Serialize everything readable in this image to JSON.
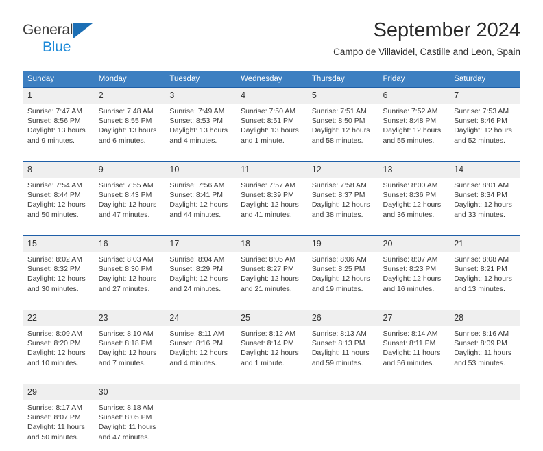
{
  "brand": {
    "name_top": "General",
    "name_bottom": "Blue",
    "triangle_color": "#1c6fb5",
    "blue_color": "#1c89d8"
  },
  "header": {
    "month_title": "September 2024",
    "location": "Campo de Villavidel, Castille and Leon, Spain"
  },
  "theme": {
    "header_bg": "#3d7fc1",
    "week_separator": "#1f5fa8",
    "daynum_bg": "#efefef"
  },
  "weekday_headers": [
    "Sunday",
    "Monday",
    "Tuesday",
    "Wednesday",
    "Thursday",
    "Friday",
    "Saturday"
  ],
  "weeks": [
    {
      "days": [
        {
          "num": "1",
          "sunrise": "Sunrise: 7:47 AM",
          "sunset": "Sunset: 8:56 PM",
          "daylight_1": "Daylight: 13 hours",
          "daylight_2": "and 9 minutes."
        },
        {
          "num": "2",
          "sunrise": "Sunrise: 7:48 AM",
          "sunset": "Sunset: 8:55 PM",
          "daylight_1": "Daylight: 13 hours",
          "daylight_2": "and 6 minutes."
        },
        {
          "num": "3",
          "sunrise": "Sunrise: 7:49 AM",
          "sunset": "Sunset: 8:53 PM",
          "daylight_1": "Daylight: 13 hours",
          "daylight_2": "and 4 minutes."
        },
        {
          "num": "4",
          "sunrise": "Sunrise: 7:50 AM",
          "sunset": "Sunset: 8:51 PM",
          "daylight_1": "Daylight: 13 hours",
          "daylight_2": "and 1 minute."
        },
        {
          "num": "5",
          "sunrise": "Sunrise: 7:51 AM",
          "sunset": "Sunset: 8:50 PM",
          "daylight_1": "Daylight: 12 hours",
          "daylight_2": "and 58 minutes."
        },
        {
          "num": "6",
          "sunrise": "Sunrise: 7:52 AM",
          "sunset": "Sunset: 8:48 PM",
          "daylight_1": "Daylight: 12 hours",
          "daylight_2": "and 55 minutes."
        },
        {
          "num": "7",
          "sunrise": "Sunrise: 7:53 AM",
          "sunset": "Sunset: 8:46 PM",
          "daylight_1": "Daylight: 12 hours",
          "daylight_2": "and 52 minutes."
        }
      ]
    },
    {
      "days": [
        {
          "num": "8",
          "sunrise": "Sunrise: 7:54 AM",
          "sunset": "Sunset: 8:44 PM",
          "daylight_1": "Daylight: 12 hours",
          "daylight_2": "and 50 minutes."
        },
        {
          "num": "9",
          "sunrise": "Sunrise: 7:55 AM",
          "sunset": "Sunset: 8:43 PM",
          "daylight_1": "Daylight: 12 hours",
          "daylight_2": "and 47 minutes."
        },
        {
          "num": "10",
          "sunrise": "Sunrise: 7:56 AM",
          "sunset": "Sunset: 8:41 PM",
          "daylight_1": "Daylight: 12 hours",
          "daylight_2": "and 44 minutes."
        },
        {
          "num": "11",
          "sunrise": "Sunrise: 7:57 AM",
          "sunset": "Sunset: 8:39 PM",
          "daylight_1": "Daylight: 12 hours",
          "daylight_2": "and 41 minutes."
        },
        {
          "num": "12",
          "sunrise": "Sunrise: 7:58 AM",
          "sunset": "Sunset: 8:37 PM",
          "daylight_1": "Daylight: 12 hours",
          "daylight_2": "and 38 minutes."
        },
        {
          "num": "13",
          "sunrise": "Sunrise: 8:00 AM",
          "sunset": "Sunset: 8:36 PM",
          "daylight_1": "Daylight: 12 hours",
          "daylight_2": "and 36 minutes."
        },
        {
          "num": "14",
          "sunrise": "Sunrise: 8:01 AM",
          "sunset": "Sunset: 8:34 PM",
          "daylight_1": "Daylight: 12 hours",
          "daylight_2": "and 33 minutes."
        }
      ]
    },
    {
      "days": [
        {
          "num": "15",
          "sunrise": "Sunrise: 8:02 AM",
          "sunset": "Sunset: 8:32 PM",
          "daylight_1": "Daylight: 12 hours",
          "daylight_2": "and 30 minutes."
        },
        {
          "num": "16",
          "sunrise": "Sunrise: 8:03 AM",
          "sunset": "Sunset: 8:30 PM",
          "daylight_1": "Daylight: 12 hours",
          "daylight_2": "and 27 minutes."
        },
        {
          "num": "17",
          "sunrise": "Sunrise: 8:04 AM",
          "sunset": "Sunset: 8:29 PM",
          "daylight_1": "Daylight: 12 hours",
          "daylight_2": "and 24 minutes."
        },
        {
          "num": "18",
          "sunrise": "Sunrise: 8:05 AM",
          "sunset": "Sunset: 8:27 PM",
          "daylight_1": "Daylight: 12 hours",
          "daylight_2": "and 21 minutes."
        },
        {
          "num": "19",
          "sunrise": "Sunrise: 8:06 AM",
          "sunset": "Sunset: 8:25 PM",
          "daylight_1": "Daylight: 12 hours",
          "daylight_2": "and 19 minutes."
        },
        {
          "num": "20",
          "sunrise": "Sunrise: 8:07 AM",
          "sunset": "Sunset: 8:23 PM",
          "daylight_1": "Daylight: 12 hours",
          "daylight_2": "and 16 minutes."
        },
        {
          "num": "21",
          "sunrise": "Sunrise: 8:08 AM",
          "sunset": "Sunset: 8:21 PM",
          "daylight_1": "Daylight: 12 hours",
          "daylight_2": "and 13 minutes."
        }
      ]
    },
    {
      "days": [
        {
          "num": "22",
          "sunrise": "Sunrise: 8:09 AM",
          "sunset": "Sunset: 8:20 PM",
          "daylight_1": "Daylight: 12 hours",
          "daylight_2": "and 10 minutes."
        },
        {
          "num": "23",
          "sunrise": "Sunrise: 8:10 AM",
          "sunset": "Sunset: 8:18 PM",
          "daylight_1": "Daylight: 12 hours",
          "daylight_2": "and 7 minutes."
        },
        {
          "num": "24",
          "sunrise": "Sunrise: 8:11 AM",
          "sunset": "Sunset: 8:16 PM",
          "daylight_1": "Daylight: 12 hours",
          "daylight_2": "and 4 minutes."
        },
        {
          "num": "25",
          "sunrise": "Sunrise: 8:12 AM",
          "sunset": "Sunset: 8:14 PM",
          "daylight_1": "Daylight: 12 hours",
          "daylight_2": "and 1 minute."
        },
        {
          "num": "26",
          "sunrise": "Sunrise: 8:13 AM",
          "sunset": "Sunset: 8:13 PM",
          "daylight_1": "Daylight: 11 hours",
          "daylight_2": "and 59 minutes."
        },
        {
          "num": "27",
          "sunrise": "Sunrise: 8:14 AM",
          "sunset": "Sunset: 8:11 PM",
          "daylight_1": "Daylight: 11 hours",
          "daylight_2": "and 56 minutes."
        },
        {
          "num": "28",
          "sunrise": "Sunrise: 8:16 AM",
          "sunset": "Sunset: 8:09 PM",
          "daylight_1": "Daylight: 11 hours",
          "daylight_2": "and 53 minutes."
        }
      ]
    },
    {
      "days": [
        {
          "num": "29",
          "sunrise": "Sunrise: 8:17 AM",
          "sunset": "Sunset: 8:07 PM",
          "daylight_1": "Daylight: 11 hours",
          "daylight_2": "and 50 minutes."
        },
        {
          "num": "30",
          "sunrise": "Sunrise: 8:18 AM",
          "sunset": "Sunset: 8:05 PM",
          "daylight_1": "Daylight: 11 hours",
          "daylight_2": "and 47 minutes."
        },
        {
          "num": "",
          "sunrise": "",
          "sunset": "",
          "daylight_1": "",
          "daylight_2": ""
        },
        {
          "num": "",
          "sunrise": "",
          "sunset": "",
          "daylight_1": "",
          "daylight_2": ""
        },
        {
          "num": "",
          "sunrise": "",
          "sunset": "",
          "daylight_1": "",
          "daylight_2": ""
        },
        {
          "num": "",
          "sunrise": "",
          "sunset": "",
          "daylight_1": "",
          "daylight_2": ""
        },
        {
          "num": "",
          "sunrise": "",
          "sunset": "",
          "daylight_1": "",
          "daylight_2": ""
        }
      ]
    }
  ]
}
